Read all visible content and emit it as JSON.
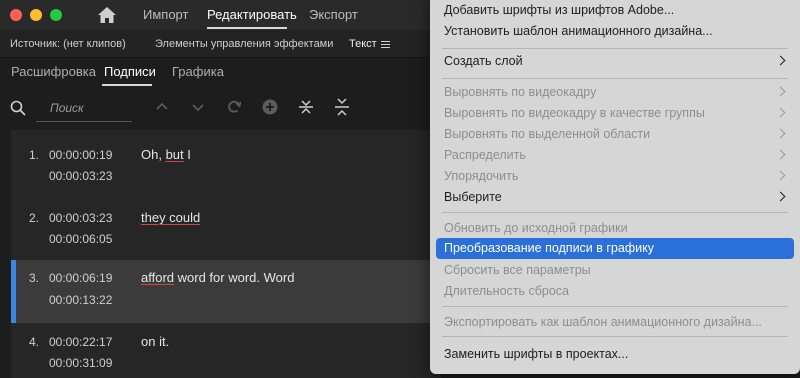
{
  "window": {
    "traffic_lights": [
      "#ff5f57",
      "#febc2e",
      "#28c840"
    ],
    "tabs": [
      {
        "label": "Импорт"
      },
      {
        "label": "Редактировать",
        "active": true
      },
      {
        "label": "Экспорт"
      }
    ]
  },
  "panel_header": {
    "source": "Источник: (нет клипов)",
    "effects": "Элементы управления эффектами",
    "text": "Текст"
  },
  "sub_tabs": [
    {
      "label": "Расшифровка"
    },
    {
      "label": "Подписи",
      "active": true
    },
    {
      "label": "Графика"
    }
  ],
  "search": {
    "placeholder": "Поиск"
  },
  "toolbar_icons": [
    "chevron-up-icon",
    "chevron-down-icon",
    "refresh-icon",
    "add-circle-icon",
    "merge-icon",
    "split-icon"
  ],
  "captions": [
    {
      "num": "1.",
      "start": "00:00:00:19",
      "end": "00:00:03:23",
      "parts": [
        {
          "t": "Oh, ",
          "e": false
        },
        {
          "t": "but",
          "e": true
        },
        {
          "t": " I",
          "e": false
        }
      ]
    },
    {
      "num": "2.",
      "start": "00:00:03:23",
      "end": "00:00:06:05",
      "parts": [
        {
          "t": "they could ",
          "e": true
        }
      ]
    },
    {
      "num": "3.",
      "start": "00:00:06:19",
      "end": "00:00:13:22",
      "parts": [
        {
          "t": "afford",
          "e": true
        },
        {
          "t": " word for word. Word",
          "e": false
        }
      ],
      "selected": true
    },
    {
      "num": "4.",
      "start": "00:00:22:17",
      "end": "00:00:31:09",
      "parts": [
        {
          "t": "on it.",
          "e": false
        }
      ]
    }
  ],
  "accent_color": "#3b85e5",
  "menu": {
    "groups": [
      [
        {
          "label": "Добавить шрифты из шрифтов Adobe..."
        },
        {
          "label": "Установить шаблон анимационного дизайна..."
        }
      ],
      [
        {
          "label": "Создать слой",
          "submenu": true
        }
      ],
      [
        {
          "label": "Выровнять по видеокадру",
          "disabled": true,
          "submenu": true
        },
        {
          "label": "Выровнять по видеокадру в качестве группы",
          "disabled": true,
          "submenu": true
        },
        {
          "label": "Выровнять по выделенной области",
          "disabled": true,
          "submenu": true
        },
        {
          "label": "Распределить",
          "disabled": true,
          "submenu": true
        },
        {
          "label": "Упорядочить",
          "disabled": true,
          "submenu": true
        },
        {
          "label": "Выберите",
          "submenu": true
        }
      ],
      [
        {
          "label": "Обновить до исходной графики",
          "disabled": true
        },
        {
          "label": "Преобразование подписи в графику",
          "highlighted": true
        },
        {
          "label": "Сбросить все параметры",
          "disabled": true
        },
        {
          "label": "Длительность сброса",
          "disabled": true
        }
      ],
      [
        {
          "label": "Экспортировать как шаблон анимационного дизайна...",
          "disabled": true
        }
      ],
      [
        {
          "label": "Заменить шрифты в проектах..."
        }
      ]
    ]
  }
}
